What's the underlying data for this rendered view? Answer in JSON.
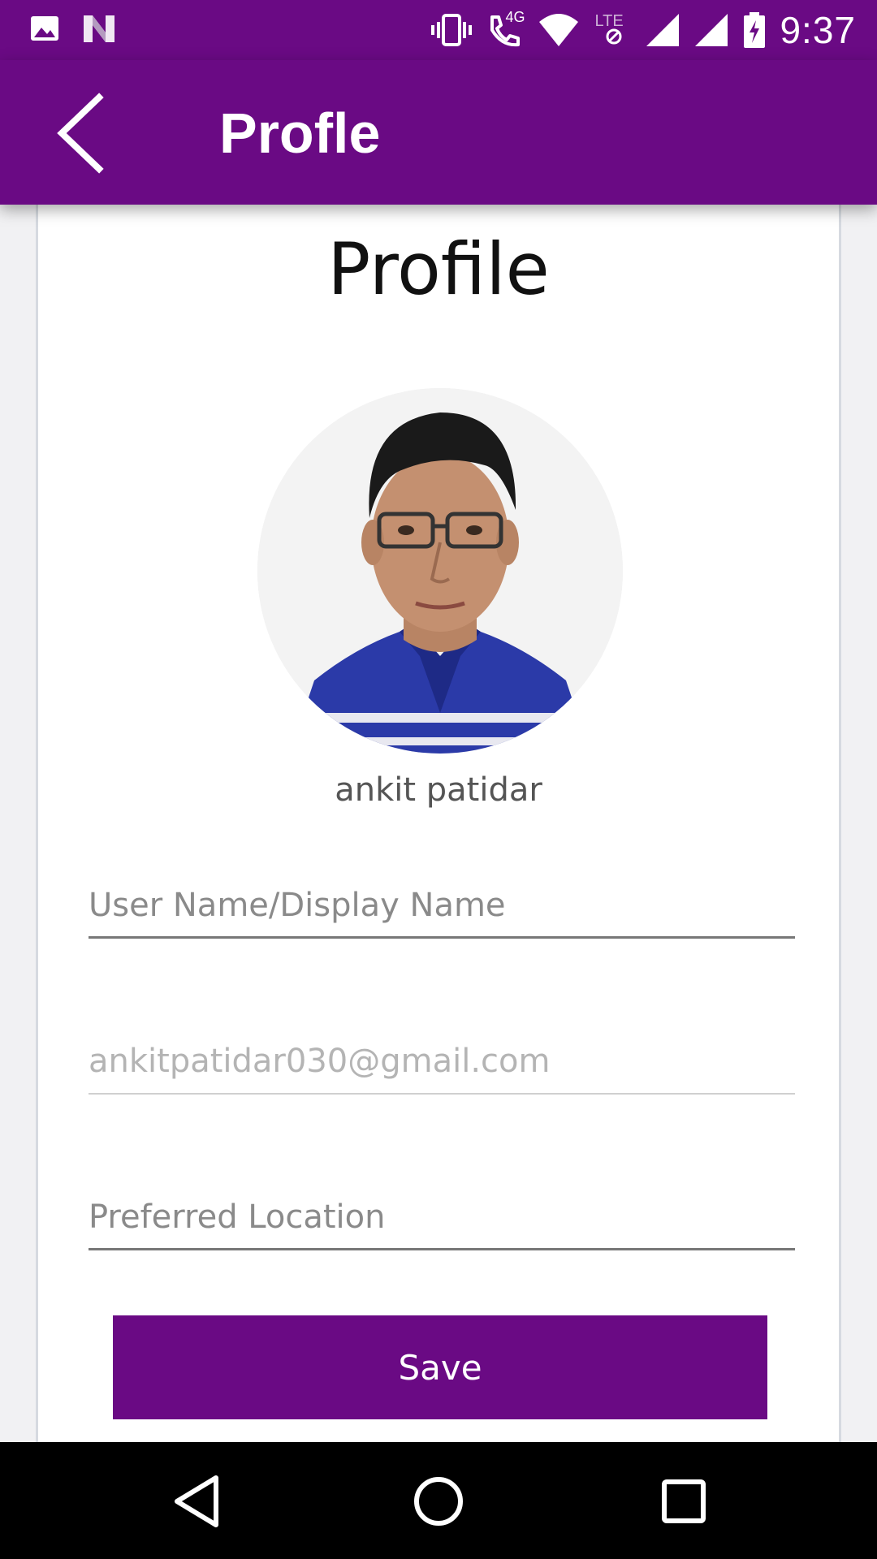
{
  "status_bar": {
    "time": "9:37",
    "network_label": "4G",
    "lte_label": "LTE",
    "icons": [
      "image-icon",
      "n-icon",
      "vibrate-icon",
      "wifi-call-icon",
      "wifi-icon",
      "lte-icon",
      "signal-icon",
      "signal-icon",
      "battery-charging-icon"
    ]
  },
  "app_bar": {
    "title": "Profle",
    "back_icon": "chevron-left-icon"
  },
  "profile": {
    "heading": "Profile",
    "user_name": "ankit patidar",
    "avatar_icon": "avatar-photo"
  },
  "form": {
    "username_placeholder": "User Name/Display Name",
    "email_value": "ankitpatidar030@gmail.com",
    "location_placeholder": "Preferred Location",
    "save_label": "Save"
  },
  "nav_bar": {
    "icons": [
      "nav-back-icon",
      "nav-home-icon",
      "nav-recents-icon"
    ]
  },
  "colors": {
    "primary": "#6a0a84",
    "background": "#f1f1f3",
    "card": "#ffffff"
  }
}
